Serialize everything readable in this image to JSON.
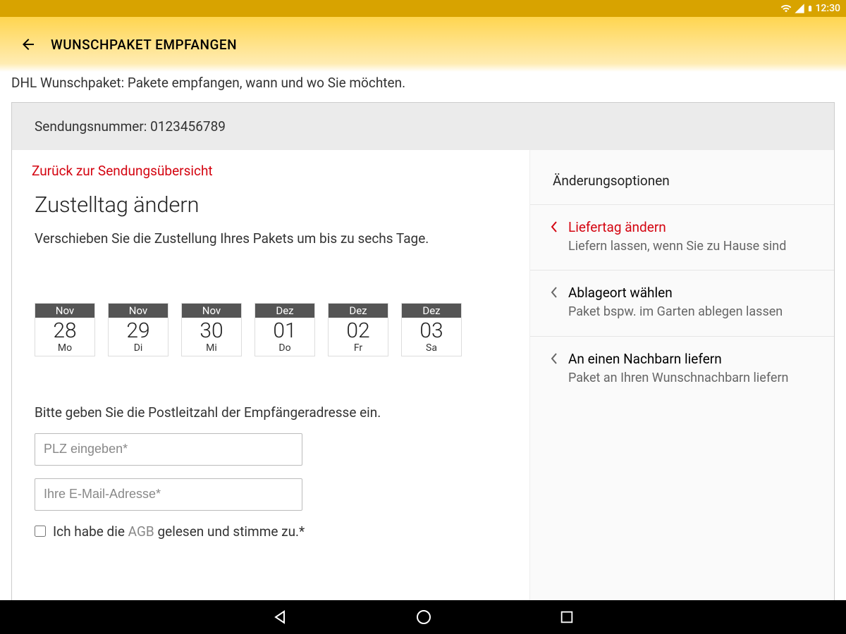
{
  "status": {
    "time": "12:30"
  },
  "appbar": {
    "title": "WUNSCHPAKET EMPFANGEN"
  },
  "subtitle": "DHL Wunschpaket: Pakete empfangen, wann und wo Sie möchten.",
  "shipment": {
    "label": "Sendungsnummer:",
    "number": "0123456789"
  },
  "main": {
    "back_link": "Zurück zur Sendungsübersicht",
    "heading": "Zustelltag ändern",
    "description": "Verschieben Sie die Zustellung Ihres Pakets um bis zu sechs Tage.",
    "dates": [
      {
        "month": "Nov",
        "day": "28",
        "dow": "Mo"
      },
      {
        "month": "Nov",
        "day": "29",
        "dow": "Di"
      },
      {
        "month": "Nov",
        "day": "30",
        "dow": "Mi"
      },
      {
        "month": "Dez",
        "day": "01",
        "dow": "Do"
      },
      {
        "month": "Dez",
        "day": "02",
        "dow": "Fr"
      },
      {
        "month": "Dez",
        "day": "03",
        "dow": "Sa"
      }
    ],
    "plz_prompt": "Bitte geben Sie die Postleitzahl der Empfängeradresse ein.",
    "plz_placeholder": "PLZ eingeben*",
    "email_placeholder": "Ihre E-Mail-Adresse*",
    "agb_prefix": "Ich habe die ",
    "agb_link": "AGB",
    "agb_suffix": " gelesen und stimme zu.*"
  },
  "side": {
    "title": "Änderungsoptionen",
    "options": [
      {
        "label": "Liefertag ändern",
        "sub": "Liefern lassen, wenn Sie zu Hause sind",
        "active": true
      },
      {
        "label": "Ablageort wählen",
        "sub": "Paket bspw. im Garten ablegen lassen",
        "active": false
      },
      {
        "label": "An einen Nachbarn liefern",
        "sub": "Paket an Ihren Wunschnachbarn liefern",
        "active": false
      }
    ]
  }
}
